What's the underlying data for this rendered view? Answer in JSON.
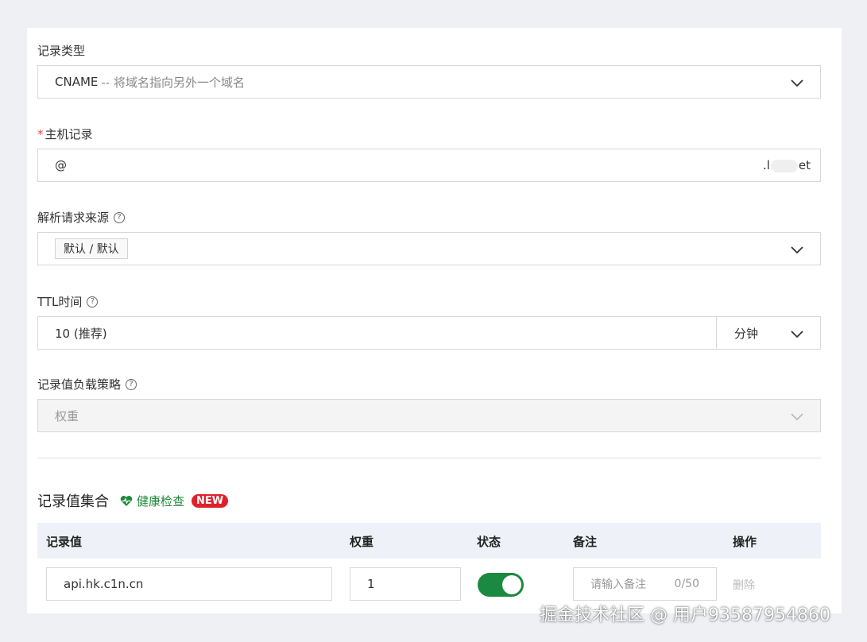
{
  "form": {
    "record_type": {
      "label": "记录类型",
      "value": "CNAME",
      "hint": "-- 将域名指向另外一个域名"
    },
    "host": {
      "required_mark": "*",
      "label": "主机记录",
      "value": "@",
      "suffix_start": ".l",
      "suffix_end": "et"
    },
    "source": {
      "label": "解析请求来源",
      "tag": "默认 / 默认"
    },
    "ttl": {
      "label": "TTL时间",
      "value": "10 (推荐)",
      "unit": "分钟"
    },
    "strategy": {
      "label": "记录值负载策略",
      "value": "权重"
    }
  },
  "records": {
    "title": "记录值集合",
    "health_check": "健康检查",
    "new_badge": "NEW",
    "columns": [
      "记录值",
      "权重",
      "状态",
      "备注",
      "操作"
    ],
    "rows": [
      {
        "value": "api.hk.c1n.cn",
        "weight": "1",
        "status_on": true,
        "note_placeholder": "请输入备注",
        "note_counter": "0/50",
        "action": "删除"
      }
    ]
  },
  "watermark": "掘金技术社区 @ 用户93587954860",
  "colors": {
    "accent_green": "#1a8a41",
    "badge_red": "#e0202a",
    "required_red": "#e5484d"
  }
}
